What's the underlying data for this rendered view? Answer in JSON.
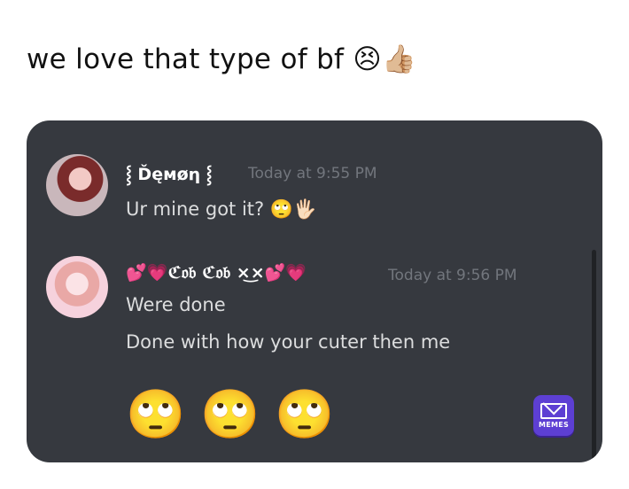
{
  "caption": "we love that type of bf 😣👍🏼",
  "chat": {
    "messages": [
      {
        "username": "⸾ Ďęмøη ⸾",
        "timestamp": "Today at 9:55 PM",
        "lines": [
          "Ur mine got it? 🙄🖐🏻"
        ]
      },
      {
        "username": "💕💗ℭ𝔬𝔟 ℭ𝔬𝔟 ×͜×💕💗",
        "timestamp": "Today at 9:56 PM",
        "lines": [
          "Were done",
          "Done with how your cuter then me"
        ],
        "big_emojis": [
          "🙄",
          "🙄",
          "🙄"
        ]
      }
    ]
  },
  "watermark": {
    "label": "MEMES",
    "icon": "envelope-icon",
    "color": "#5d3fd3"
  },
  "colors": {
    "panel_bg": "#36393f",
    "text": "#dcddde",
    "timestamp": "#72767d",
    "username": "#ffffff"
  }
}
